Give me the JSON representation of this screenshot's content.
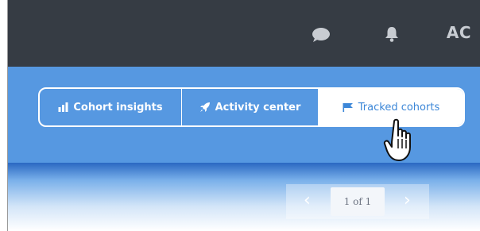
{
  "header": {
    "user_initials": "AC",
    "icons": [
      "chat-icon",
      "bell-icon"
    ]
  },
  "tabs": [
    {
      "label": "Cohort insights",
      "icon": "bar-chart-icon",
      "active": false
    },
    {
      "label": "Activity center",
      "icon": "rocket-icon",
      "active": false
    },
    {
      "label": "Tracked cohorts",
      "icon": "flag-icon",
      "active": true
    }
  ],
  "pagination": {
    "label": "1 of 1"
  },
  "colors": {
    "topbar": "#363c44",
    "accent": "#5698e1",
    "active_tab_text": "#3c87d8"
  }
}
